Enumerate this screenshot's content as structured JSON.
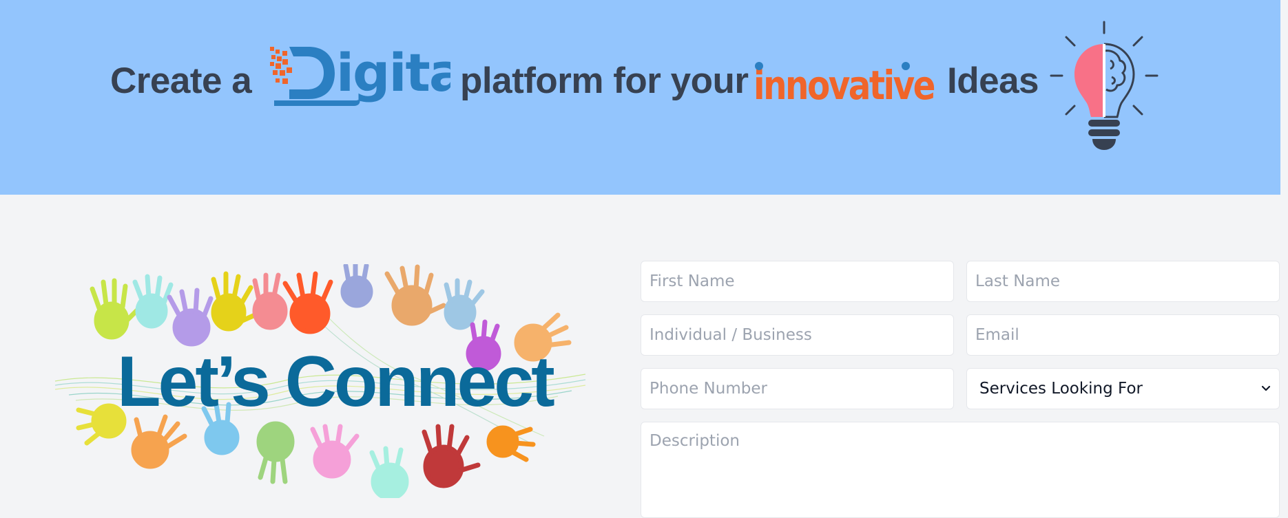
{
  "banner": {
    "prefix": "Create a",
    "digital_word": "igital",
    "middle": "platform for your",
    "innovative_word": "innovative",
    "suffix": "Ideas",
    "colors": {
      "background": "#93c5fd",
      "text": "#374151",
      "digital_blue": "#2b7fc2",
      "innovative_orange": "#f0652a",
      "bulb_pink": "#f87187"
    }
  },
  "illustration": {
    "title": "Let’s Connect",
    "title_color": "#0b6a9a",
    "icon": "colorful-handprints"
  },
  "form": {
    "first_name": {
      "placeholder": "First Name",
      "value": ""
    },
    "last_name": {
      "placeholder": "Last Name",
      "value": ""
    },
    "individual_business": {
      "placeholder": "Individual / Business",
      "value": ""
    },
    "email": {
      "placeholder": "Email",
      "value": ""
    },
    "phone": {
      "placeholder": "Phone Number",
      "value": ""
    },
    "services": {
      "selected": "Services Looking For",
      "icon": "chevron-down-icon"
    },
    "description": {
      "placeholder": "Description",
      "value": ""
    }
  }
}
